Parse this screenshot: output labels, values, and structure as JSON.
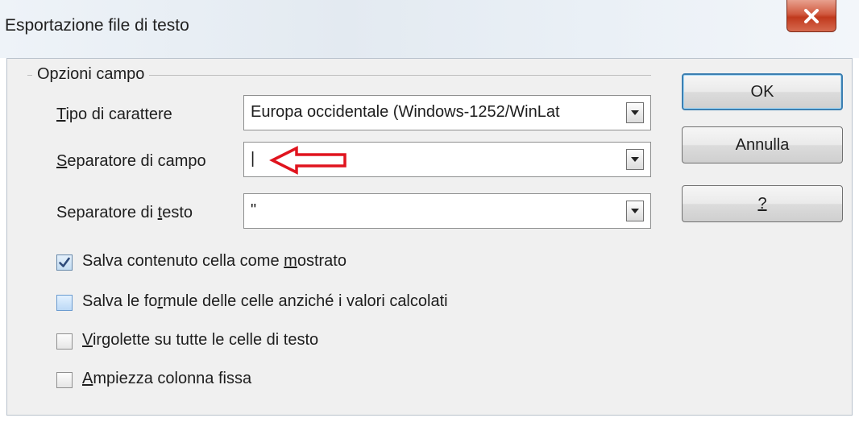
{
  "dialog": {
    "title": "Esportazione file di testo"
  },
  "field_options": {
    "group_label": "Opzioni campo",
    "charset": {
      "label_first": "T",
      "label_rest": "ipo di carattere",
      "value": "Europa occidentale (Windows-1252/WinLat"
    },
    "field_separator": {
      "label_first": "S",
      "label_rest": "eparatore di campo",
      "value": "|"
    },
    "text_separator": {
      "label_pre": "Separatore di ",
      "label_mnemonic": "t",
      "label_post": "esto",
      "value": "\""
    }
  },
  "checkboxes": [
    {
      "pre": "Salva contenuto cella come ",
      "mnemonic": "m",
      "post": "ostrato",
      "checked": true
    },
    {
      "pre": "Salva le fo",
      "mnemonic": "r",
      "post": "mule delle celle anziché i valori calcolati",
      "checked": false
    },
    {
      "pre": "",
      "mnemonic": "V",
      "post": "irgolette su tutte le celle di testo",
      "checked": false
    },
    {
      "pre": "",
      "mnemonic": "A",
      "post": "mpiezza colonna fissa",
      "checked": false
    }
  ],
  "buttons": {
    "ok": "OK",
    "cancel": "Annulla",
    "help": "?"
  },
  "colors": {
    "annotation_arrow": "#e0141e",
    "default_button_border": "#3c7fb1"
  }
}
